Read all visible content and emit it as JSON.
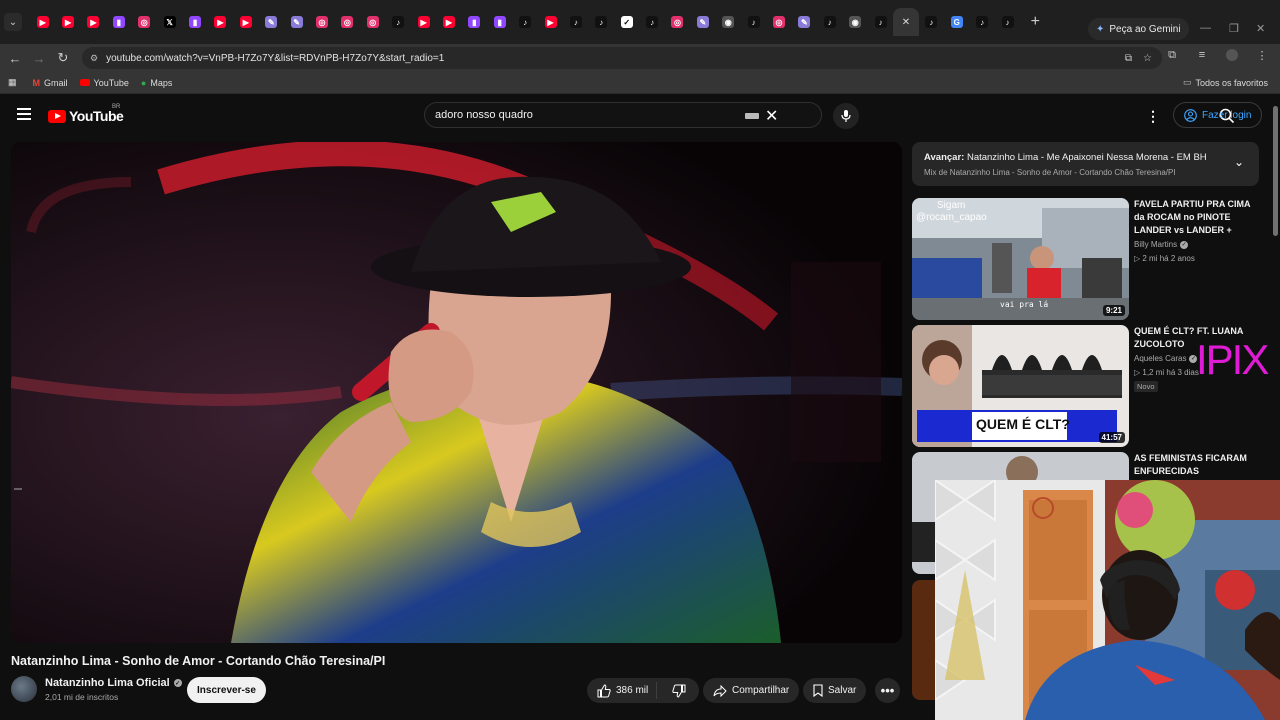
{
  "browser": {
    "active_tab_close": "✕",
    "new_tab": "+",
    "gemini_label": "Peça ao Gemini",
    "url": "youtube.com/watch?v=VnPB-H7Zo7Y&list=RDVnPB-H7Zo7Y&start_radio=1",
    "bookmarks": [
      {
        "label": "Gmail"
      },
      {
        "label": "YouTube"
      },
      {
        "label": "Maps"
      }
    ],
    "all_bookmarks": "Todos os favoritos"
  },
  "youtube": {
    "logo_text": "YouTube",
    "country_code": "BR",
    "search_query": "adoro nosso quadro",
    "login_label": "Fazer login"
  },
  "video": {
    "title": "Natanzinho Lima - Sonho de Amor - Cortando Chão Teresina/PI",
    "channel": "Natanzinho Lima Oficial",
    "subscribers": "2,01 mi de inscritos",
    "subscribe_label": "Inscrever-se",
    "likes": "386 mil",
    "share_label": "Compartilhar",
    "save_label": "Salvar",
    "more_label": "•••"
  },
  "up_next": {
    "prefix": "Avançar:",
    "title": "Natanzinho Lima - Me Apaixonei Nessa Morena - EM BH",
    "subtitle": "Mix de Natanzinho Lima - Sonho de Amor - Cortando Chão Teresina/PI"
  },
  "recommendations": [
    {
      "title": "FAVELA PARTIU PRA CIMA da ROCAM no PINOTE LANDER vs LANDER +",
      "channel": "Billy Martins",
      "meta": "▷ 2 mi  há 2 anos",
      "duration": "9:21",
      "thumb_caption_top": "Sigam",
      "thumb_caption_handle": "@rocam_capao",
      "thumb_caption_bottom": "vai pra lá"
    },
    {
      "title": "QUEM É CLT? FT. LUANA ZUCOLOTO",
      "channel": "Aqueles Caras",
      "meta": "▷ 1,2 mi  há 3 dias",
      "badge": "Novo",
      "duration": "41:57",
      "thumb_caption": "QUEM É CLT?"
    },
    {
      "title": "AS FEMINISTAS FICARAM ENFURECIDAS"
    }
  ],
  "overlay_text": "IPIX",
  "colors": {
    "youtube_red": "#ff0000",
    "link_blue": "#3ea6ff",
    "background": "#0f0f0f",
    "overlay_magenta": "#e01bd6"
  }
}
